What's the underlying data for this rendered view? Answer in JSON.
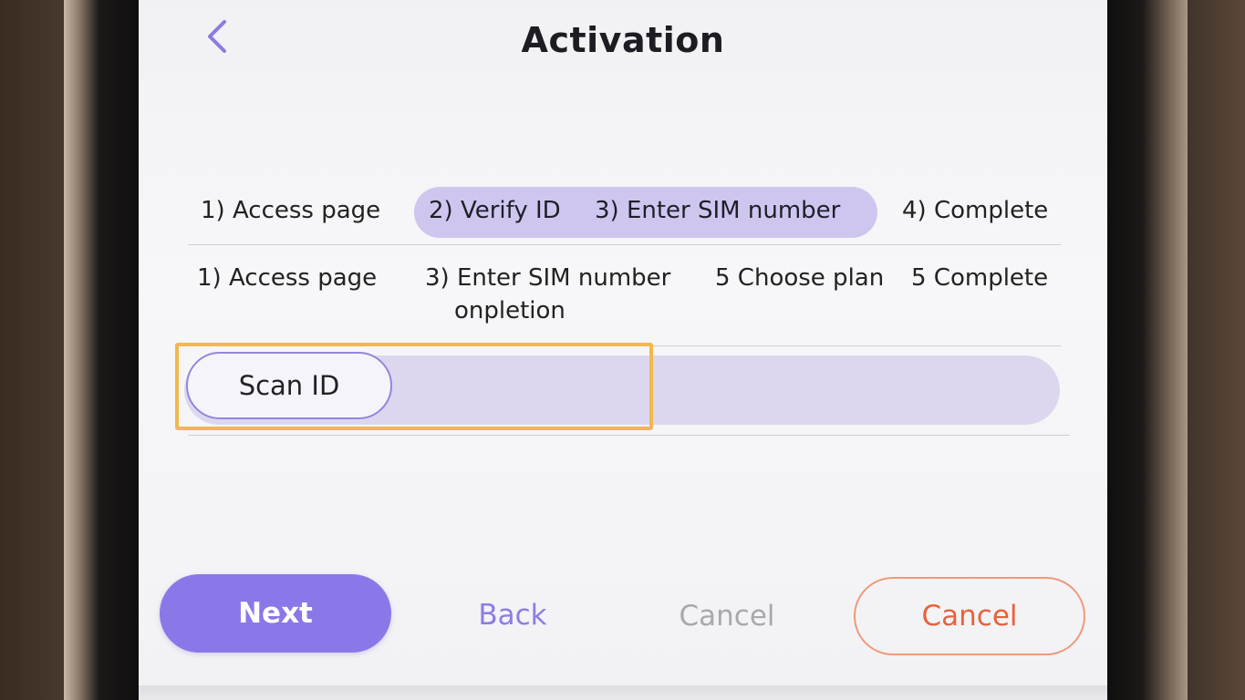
{
  "header": {
    "title": "Activation",
    "back_icon": "chevron-left-icon"
  },
  "stepper": {
    "steps": [
      {
        "label": "1) Access page",
        "active": false
      },
      {
        "label": "2) Verify ID",
        "active": true
      },
      {
        "label": "3) Enter SIM number",
        "active": true
      },
      {
        "label": "4) Complete",
        "active": false
      }
    ]
  },
  "substeps": {
    "items": [
      {
        "label": "1) Access page"
      },
      {
        "label": "3) Enter SIM number",
        "sub": "onpletion"
      },
      {
        "label": "5 Choose plan"
      },
      {
        "label": "5 Complete"
      }
    ]
  },
  "scan": {
    "button_label": "Scan ID"
  },
  "actions": {
    "next_label": "Next",
    "back_label": "Back",
    "cancel_text_label": "Cancel",
    "cancel_outline_label": "Cancel"
  },
  "colors": {
    "accent": "#8b78e8",
    "pill": "#cfc6f0",
    "highlight": "#f2b84b",
    "cancel": "#e8623a"
  }
}
